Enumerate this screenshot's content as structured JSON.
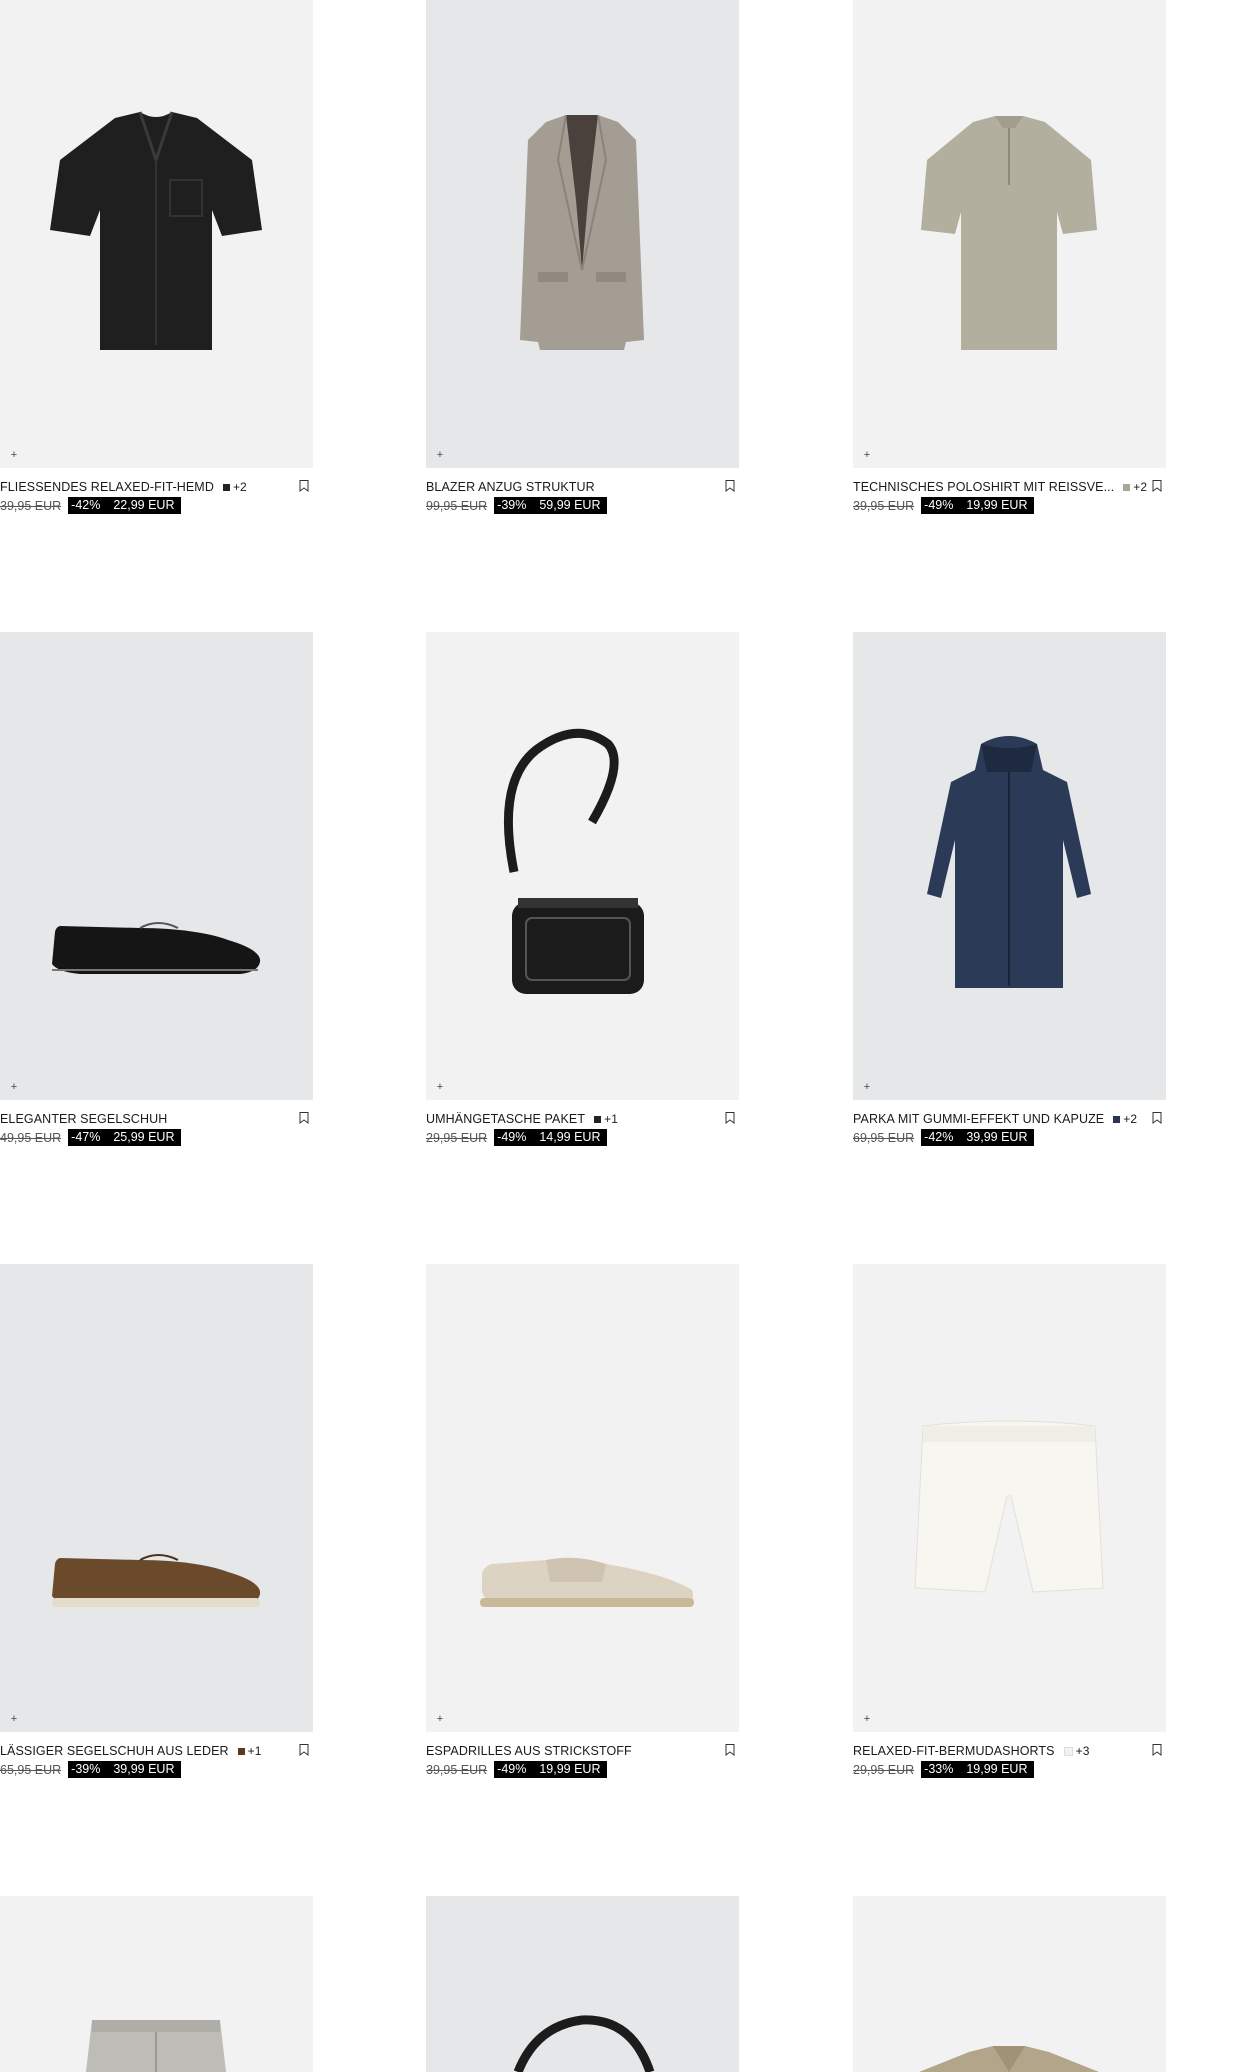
{
  "products": [
    {
      "name": "FLIESSENDES RELAXED-FIT-HEMD",
      "swatch_color": "#222222",
      "more_colors": "+2",
      "old_price": "39,95 EUR",
      "discount": "-42%",
      "new_price": "22,99 EUR",
      "bg": "#f2f2f2",
      "icon": "short-sleeve-shirt-icon"
    },
    {
      "name": "BLAZER ANZUG STRUKTUR",
      "swatch_color": "",
      "more_colors": "",
      "old_price": "99,95 EUR",
      "discount": "-39%",
      "new_price": "59,99 EUR",
      "bg": "#e5e7e9",
      "icon": "blazer-icon"
    },
    {
      "name": "TECHNISCHES POLOSHIRT MIT REISSVE...",
      "swatch_color": "#a8a695",
      "more_colors": "+2",
      "old_price": "39,95 EUR",
      "discount": "-49%",
      "new_price": "19,99 EUR",
      "bg": "#f2f2f2",
      "icon": "polo-shirt-icon"
    },
    {
      "name": "ELEGANTER SEGELSCHUH",
      "swatch_color": "",
      "more_colors": "",
      "old_price": "49,95 EUR",
      "discount": "-47%",
      "new_price": "25,99 EUR",
      "bg": "#e5e7e9",
      "icon": "boat-shoe-icon"
    },
    {
      "name": "UMHÄNGETASCHE PAKET",
      "swatch_color": "#222222",
      "more_colors": "+1",
      "old_price": "29,95 EUR",
      "discount": "-49%",
      "new_price": "14,99 EUR",
      "bg": "#f2f2f2",
      "icon": "crossbody-bag-icon"
    },
    {
      "name": "PARKA MIT GUMMI-EFFEKT UND KAPUZE",
      "swatch_color": "#2b3550",
      "more_colors": "+2",
      "old_price": "69,95 EUR",
      "discount": "-42%",
      "new_price": "39,99 EUR",
      "bg": "#e5e7e9",
      "icon": "parka-icon"
    },
    {
      "name": "LÄSSIGER SEGELSCHUH AUS LEDER",
      "swatch_color": "#5a3b22",
      "more_colors": "+1",
      "old_price": "65,95 EUR",
      "discount": "-39%",
      "new_price": "39,99 EUR",
      "bg": "#e5e7e9",
      "icon": "boat-shoe-icon"
    },
    {
      "name": "ESPADRILLES AUS STRICKSTOFF",
      "swatch_color": "",
      "more_colors": "",
      "old_price": "39,95 EUR",
      "discount": "-49%",
      "new_price": "19,99 EUR",
      "bg": "#f2f2f2",
      "icon": "espadrille-icon"
    },
    {
      "name": "RELAXED-FIT-BERMUDASHORTS",
      "swatch_color": "#f2f2ee",
      "more_colors": "+3",
      "old_price": "29,95 EUR",
      "discount": "-33%",
      "new_price": "19,99 EUR",
      "bg": "#f2f2f2",
      "icon": "shorts-icon"
    },
    {
      "name": "",
      "swatch_color": "",
      "more_colors": "",
      "old_price": "",
      "discount": "",
      "new_price": "",
      "bg": "#f2f2f2",
      "icon": "trousers-icon"
    },
    {
      "name": "",
      "swatch_color": "",
      "more_colors": "",
      "old_price": "",
      "discount": "",
      "new_price": "",
      "bg": "#e5e7e9",
      "icon": "bag-strap-icon"
    },
    {
      "name": "",
      "swatch_color": "",
      "more_colors": "",
      "old_price": "",
      "discount": "",
      "new_price": "",
      "bg": "#f2f2f2",
      "icon": "camp-collar-shirt-icon"
    }
  ],
  "quick_add_symbol": "+",
  "bookmark_icon": "bookmark-icon"
}
